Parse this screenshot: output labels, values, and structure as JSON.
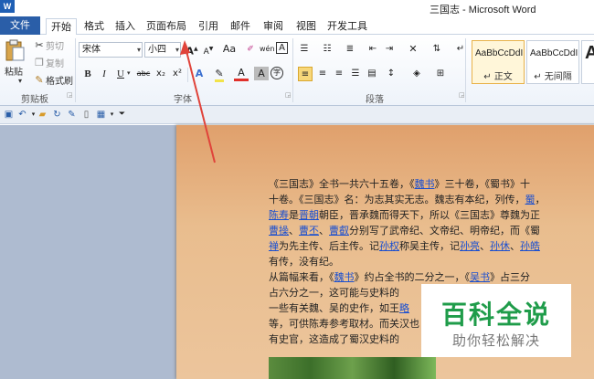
{
  "window": {
    "title": "三国志 - Microsoft Word",
    "logo_letter": "W"
  },
  "tabs": {
    "file": "文件",
    "items": [
      "开始",
      "格式",
      "插入",
      "页面布局",
      "引用",
      "邮件",
      "审阅",
      "视图",
      "开发工具"
    ]
  },
  "clipboard": {
    "paste": "粘贴",
    "cut": "剪切",
    "copy": "复制",
    "format_painter": "格式刷",
    "group": "剪贴板"
  },
  "font": {
    "name": "宋体",
    "size": "小四",
    "grow": "A",
    "shrink": "A",
    "case": "Aa",
    "phonetic": "wén",
    "bold": "B",
    "italic": "I",
    "underline": "U",
    "strike": "abc",
    "subscript": "x₂",
    "superscript": "x²",
    "text_effects": "A",
    "font_color": "A",
    "char_shade": "A",
    "enclose": "字",
    "group": "字体"
  },
  "paragraph": {
    "group": "段落"
  },
  "styles": {
    "items": [
      {
        "sample": "AaBbCcDdI",
        "name": "正文"
      },
      {
        "sample": "AaBbCcDdI",
        "name": "无间隔"
      },
      {
        "sample": "A",
        "name": ""
      }
    ]
  },
  "document": {
    "lines": [
      [
        {
          "t": "《三国志》全书一共六十五卷，《"
        },
        {
          "t": "魏书",
          "l": true
        },
        {
          "t": "》三十卷，《蜀书》十"
        }
      ],
      [
        {
          "t": "十卷。《三国志》名：为志其实无志。魏志有本纪，列传，"
        },
        {
          "t": "蜀",
          "l": true
        },
        {
          "t": "，"
        }
      ],
      [
        {
          "t": "陈寿",
          "l": true
        },
        {
          "t": "是"
        },
        {
          "t": "晋朝",
          "l": true
        },
        {
          "t": "朝臣，晋承魏而得天下，所以《三国志》尊魏为正"
        }
      ],
      [
        {
          "t": "曹操",
          "l": true
        },
        {
          "t": "、"
        },
        {
          "t": "曹丕",
          "l": true
        },
        {
          "t": "、"
        },
        {
          "t": "曹叡",
          "l": true
        },
        {
          "t": "分别写了武帝纪、文帝纪、明帝纪，而《蜀"
        }
      ],
      [
        {
          "t": "禅",
          "l": true
        },
        {
          "t": "为先主传、后主传。记"
        },
        {
          "t": "孙权",
          "l": true
        },
        {
          "t": "称吴主传，记"
        },
        {
          "t": "孙亮",
          "l": true
        },
        {
          "t": "、"
        },
        {
          "t": "孙休",
          "l": true
        },
        {
          "t": "、"
        },
        {
          "t": "孙皓",
          "l": true
        }
      ],
      [
        {
          "t": "有传，没有纪。"
        }
      ],
      [
        {
          "t": "从篇幅来看，《"
        },
        {
          "t": "魏书",
          "l": true
        },
        {
          "t": "》约占全书的二分之一，《"
        },
        {
          "t": "吴书",
          "l": true
        },
        {
          "t": "》占三分"
        }
      ],
      [
        {
          "t": "占六分之一，这可能与史料的"
        }
      ],
      [
        {
          "t": "一些有关魏、吴的史作，如王"
        },
        {
          "t": "",
          "l": false
        },
        {
          "t": "略",
          "l": true
        }
      ],
      [
        {
          "t": "等，可供陈寿参考取材。而关"
        },
        {
          "t": "汉也"
        }
      ],
      [
        {
          "t": "有史官，这造成了蜀汉史料的"
        }
      ]
    ]
  },
  "watermark": {
    "big": "百科全说",
    "small": "助你轻松解决"
  },
  "colors": {
    "file_tab": "#2a5ea8",
    "link": "#1a4fd0",
    "arrow": "#e0433a",
    "watermark_green": "#1f9c4a"
  }
}
